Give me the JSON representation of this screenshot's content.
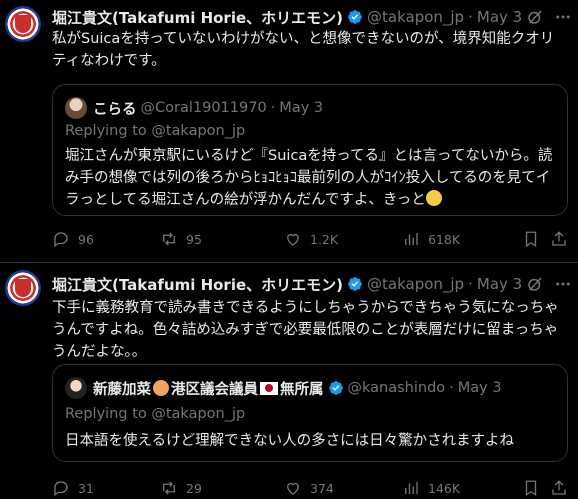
{
  "tweets": [
    {
      "author": "堀江貴文(Takafumi Horie、ホリエモン)",
      "handle": "@takapon_jp",
      "dot": "·",
      "date": "May 3",
      "text": "私がSuicaを持っていないわけがない、と想像できないのが、境界知能クオリティなわけです。",
      "quote": {
        "author": "こらる",
        "handle": "@Coral19011970",
        "dot": "·",
        "date": "May 3",
        "replying": "Replying to @takapon_jp",
        "text": "堀江さんが東京駅にいるけど『Suicaを持ってる』とは言ってないから。読み手の想像では列の後ろからﾋｮｺﾋｮｺ最前列の人がｺｲﾝ投入してるのを見てイラっとしてる堀江さんの絵が浮かんだんですよ、きっと"
      },
      "metrics": {
        "replies": "96",
        "reposts": "95",
        "likes": "1.2K",
        "views": "618K"
      }
    },
    {
      "author": "堀江貴文(Takafumi Horie、ホリエモン)",
      "handle": "@takapon_jp",
      "dot": "·",
      "date": "May 3",
      "text": "下手に義務教育で読み書きできるようにしちゃうからできちゃう気になっちゃうんですよね。色々詰め込みすぎで必要最低限のことが表層だけに留まっちゃうんだよな。。",
      "quote": {
        "author_name": "新藤加菜",
        "author_mid": "港区議会議員",
        "author_end": "無所属",
        "handle": "@kanashindo",
        "dot": "·",
        "date": "May 3",
        "replying": "Replying to @takapon_jp",
        "text": "日本語を使えるけど理解できない人の多さには日々驚かされますよね"
      },
      "metrics": {
        "replies": "31",
        "reposts": "29",
        "likes": "374",
        "views": "146K"
      }
    }
  ],
  "colors": {
    "background": "#000000",
    "text": "#e7e9ea",
    "muted": "#71767b",
    "border": "#2f3336",
    "verified": "#1d9bf0"
  },
  "icons": [
    "avatar",
    "verified-badge-icon",
    "grok-icon",
    "more-icon",
    "reply-icon",
    "repost-icon",
    "like-icon",
    "views-icon",
    "bookmark-icon",
    "share-icon"
  ]
}
